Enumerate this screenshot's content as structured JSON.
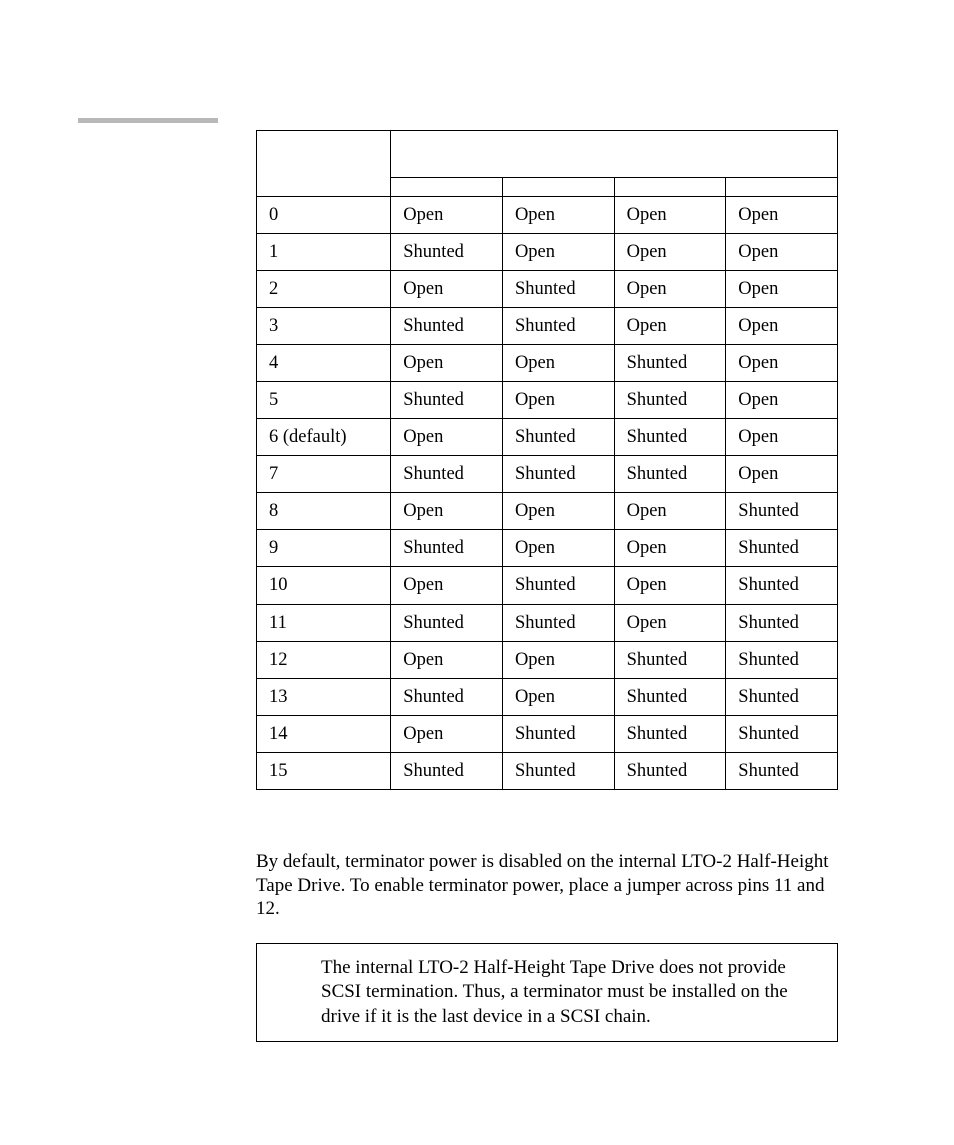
{
  "table": {
    "rows": [
      {
        "id": "0",
        "p1": "Open",
        "p2": "Open",
        "p3": "Open",
        "p4": "Open"
      },
      {
        "id": "1",
        "p1": "Shunted",
        "p2": "Open",
        "p3": "Open",
        "p4": "Open"
      },
      {
        "id": "2",
        "p1": "Open",
        "p2": "Shunted",
        "p3": "Open",
        "p4": "Open"
      },
      {
        "id": "3",
        "p1": "Shunted",
        "p2": "Shunted",
        "p3": "Open",
        "p4": "Open"
      },
      {
        "id": "4",
        "p1": "Open",
        "p2": "Open",
        "p3": "Shunted",
        "p4": "Open"
      },
      {
        "id": "5",
        "p1": "Shunted",
        "p2": "Open",
        "p3": "Shunted",
        "p4": "Open"
      },
      {
        "id": "6 (default)",
        "p1": "Open",
        "p2": "Shunted",
        "p3": "Shunted",
        "p4": "Open"
      },
      {
        "id": "7",
        "p1": "Shunted",
        "p2": "Shunted",
        "p3": "Shunted",
        "p4": "Open"
      },
      {
        "id": "8",
        "p1": "Open",
        "p2": "Open",
        "p3": "Open",
        "p4": "Shunted"
      },
      {
        "id": "9",
        "p1": "Shunted",
        "p2": "Open",
        "p3": "Open",
        "p4": "Shunted"
      },
      {
        "id": "10",
        "p1": "Open",
        "p2": "Shunted",
        "p3": "Open",
        "p4": "Shunted"
      },
      {
        "id": "11",
        "p1": "Shunted",
        "p2": "Shunted",
        "p3": "Open",
        "p4": "Shunted"
      },
      {
        "id": "12",
        "p1": "Open",
        "p2": "Open",
        "p3": "Shunted",
        "p4": "Shunted"
      },
      {
        "id": "13",
        "p1": "Shunted",
        "p2": "Open",
        "p3": "Shunted",
        "p4": "Shunted"
      },
      {
        "id": "14",
        "p1": "Open",
        "p2": "Shunted",
        "p3": "Shunted",
        "p4": "Shunted"
      },
      {
        "id": "15",
        "p1": "Shunted",
        "p2": "Shunted",
        "p3": "Shunted",
        "p4": "Shunted"
      }
    ]
  },
  "body_paragraph": "By default, terminator power is disabled on the internal LTO-2 Half-Height Tape Drive. To enable terminator power, place a jumper across pins 11 and 12.",
  "note_text": "The internal LTO-2 Half-Height Tape Drive does not provide SCSI termination. Thus, a terminator must be installed on the drive if it is the last device in a SCSI chain."
}
